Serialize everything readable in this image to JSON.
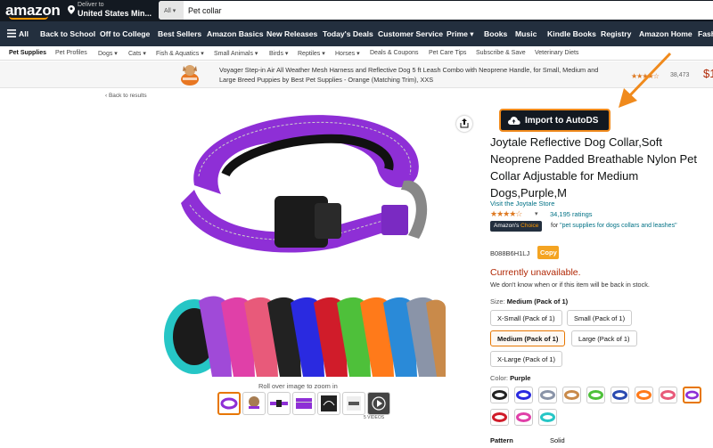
{
  "header": {
    "logo": "amazon",
    "deliver_line1": "Deliver to",
    "deliver_line2": "United States Min...",
    "search_category": "All",
    "search_value": "Pet collar"
  },
  "nav": {
    "items": [
      "All",
      "Back to School",
      "Off to College",
      "Best Sellers",
      "Amazon Basics",
      "New Releases",
      "Today's Deals",
      "Customer Service",
      "Prime",
      "Books",
      "Music",
      "Kindle Books",
      "Registry",
      "Amazon Home",
      "Fash"
    ]
  },
  "subnav": {
    "items": [
      "Pet Supplies",
      "Pet Profiles",
      "Dogs",
      "Cats",
      "Fish & Aquatics",
      "Small Animals",
      "Birds",
      "Reptiles",
      "Horses",
      "Deals & Coupons",
      "Pet Care Tips",
      "Subscribe & Save",
      "Veterinary Diets"
    ]
  },
  "ad": {
    "text": "Voyager Step-in Air All Weather Mesh Harness and Reflective Dog 5 ft Leash Combo with Neoprene Handle, for Small, Medium and Large Breed Puppies by Best Pet Supplies - Orange (Matching Trim), XXS",
    "stars": "★★★★☆",
    "rating_count": "38,473",
    "price": "$1"
  },
  "product": {
    "back_link": "‹ Back to results",
    "rollover_text": "Roll over image to zoom in",
    "videos_label": "5 VIDEOS",
    "import_button": "Import to AutoDS",
    "title": "Joytale Reflective Dog Collar,Soft Neoprene Padded Breathable Nylon Pet Collar Adjustable for Medium Dogs,Purple,M",
    "store_link": "Visit the Joytale Store",
    "stars": "★★★★☆",
    "rating_count": "34,195 ratings",
    "choice_badge_a": "Amazon's",
    "choice_badge_b": "Choice",
    "choice_for": "for",
    "choice_query": "\"pet supplies for dogs collars and leashes\"",
    "asin": "B088B6H1LJ",
    "copy_button": "Copy",
    "availability": "Currently unavailable.",
    "availability_sub": "We don't know when or if this item will be back in stock.",
    "size_label": "Size:",
    "size_value": "Medium (Pack of 1)",
    "sizes": [
      "X-Small (Pack of 1)",
      "Small (Pack of 1)",
      "Medium (Pack of 1)",
      "Large (Pack of 1)",
      "X-Large (Pack of 1)"
    ],
    "color_label": "Color:",
    "color_value": "Purple",
    "pattern_label": "Pattern",
    "pattern_value": "Solid"
  },
  "colors": {
    "accent_orange": "#f08a1c",
    "purple": "#8a2be2",
    "navy": "#131921"
  }
}
